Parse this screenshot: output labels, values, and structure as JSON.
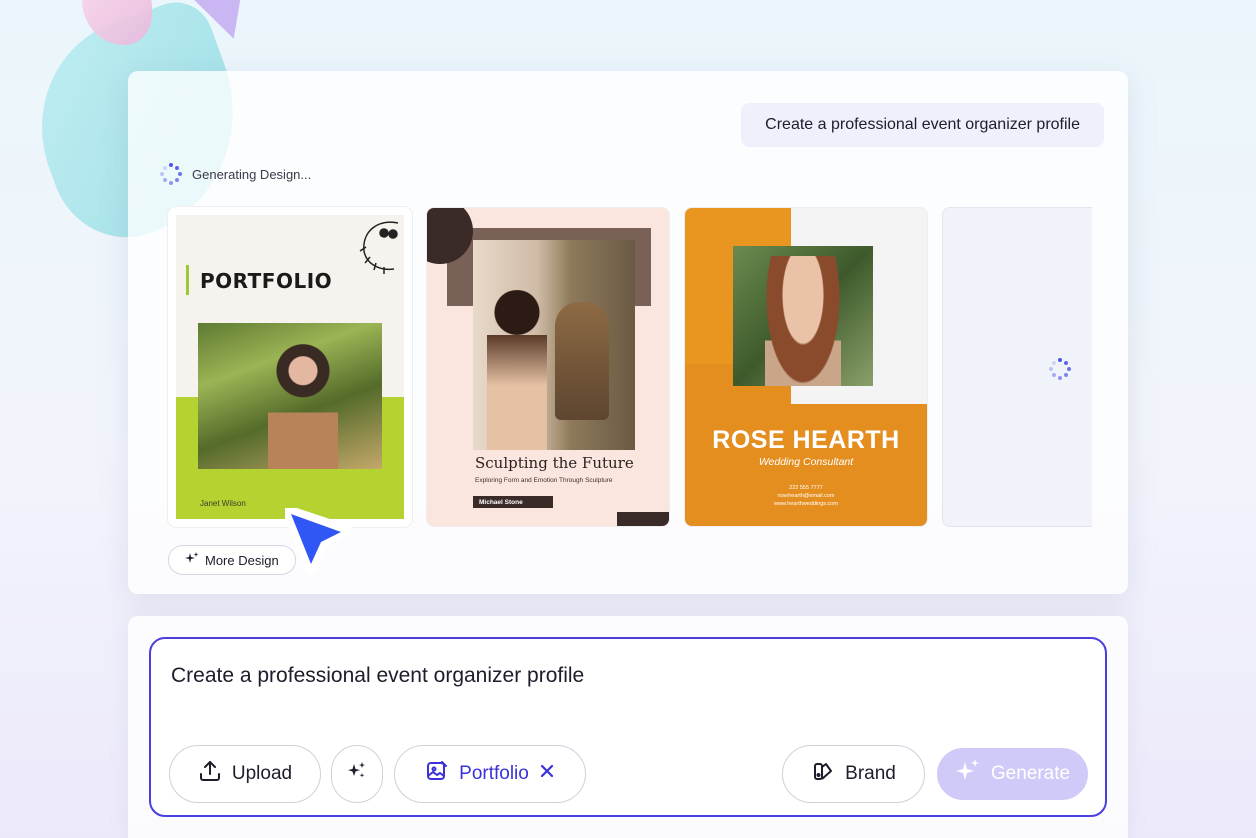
{
  "prompt": "Create a professional event organizer profile",
  "status": "Generating Design...",
  "more_design_label": "More Design",
  "cards": [
    {
      "title": "PORTFOLIO",
      "name": "Janet Wilson"
    },
    {
      "title": "Sculpting the Future",
      "subtitle": "Exploring Form and Emotion Through Sculpture",
      "author": "Michael Stone"
    },
    {
      "title": "ROSE HEARTH",
      "role": "Wedding Consultant",
      "phone": "222 555 7777",
      "email": "rosehearth@email.com",
      "website": "www.hearthweddings.com"
    }
  ],
  "input": {
    "text": "Create a professional event organizer profile",
    "upload_label": "Upload",
    "tag_label": "Portfolio",
    "brand_label": "Brand",
    "generate_label": "Generate"
  },
  "colors": {
    "accent": "#4a3ee0",
    "generate_disabled": "#cfcaf8",
    "card1_green": "#b4d331",
    "card3_orange": "#e8961f"
  }
}
